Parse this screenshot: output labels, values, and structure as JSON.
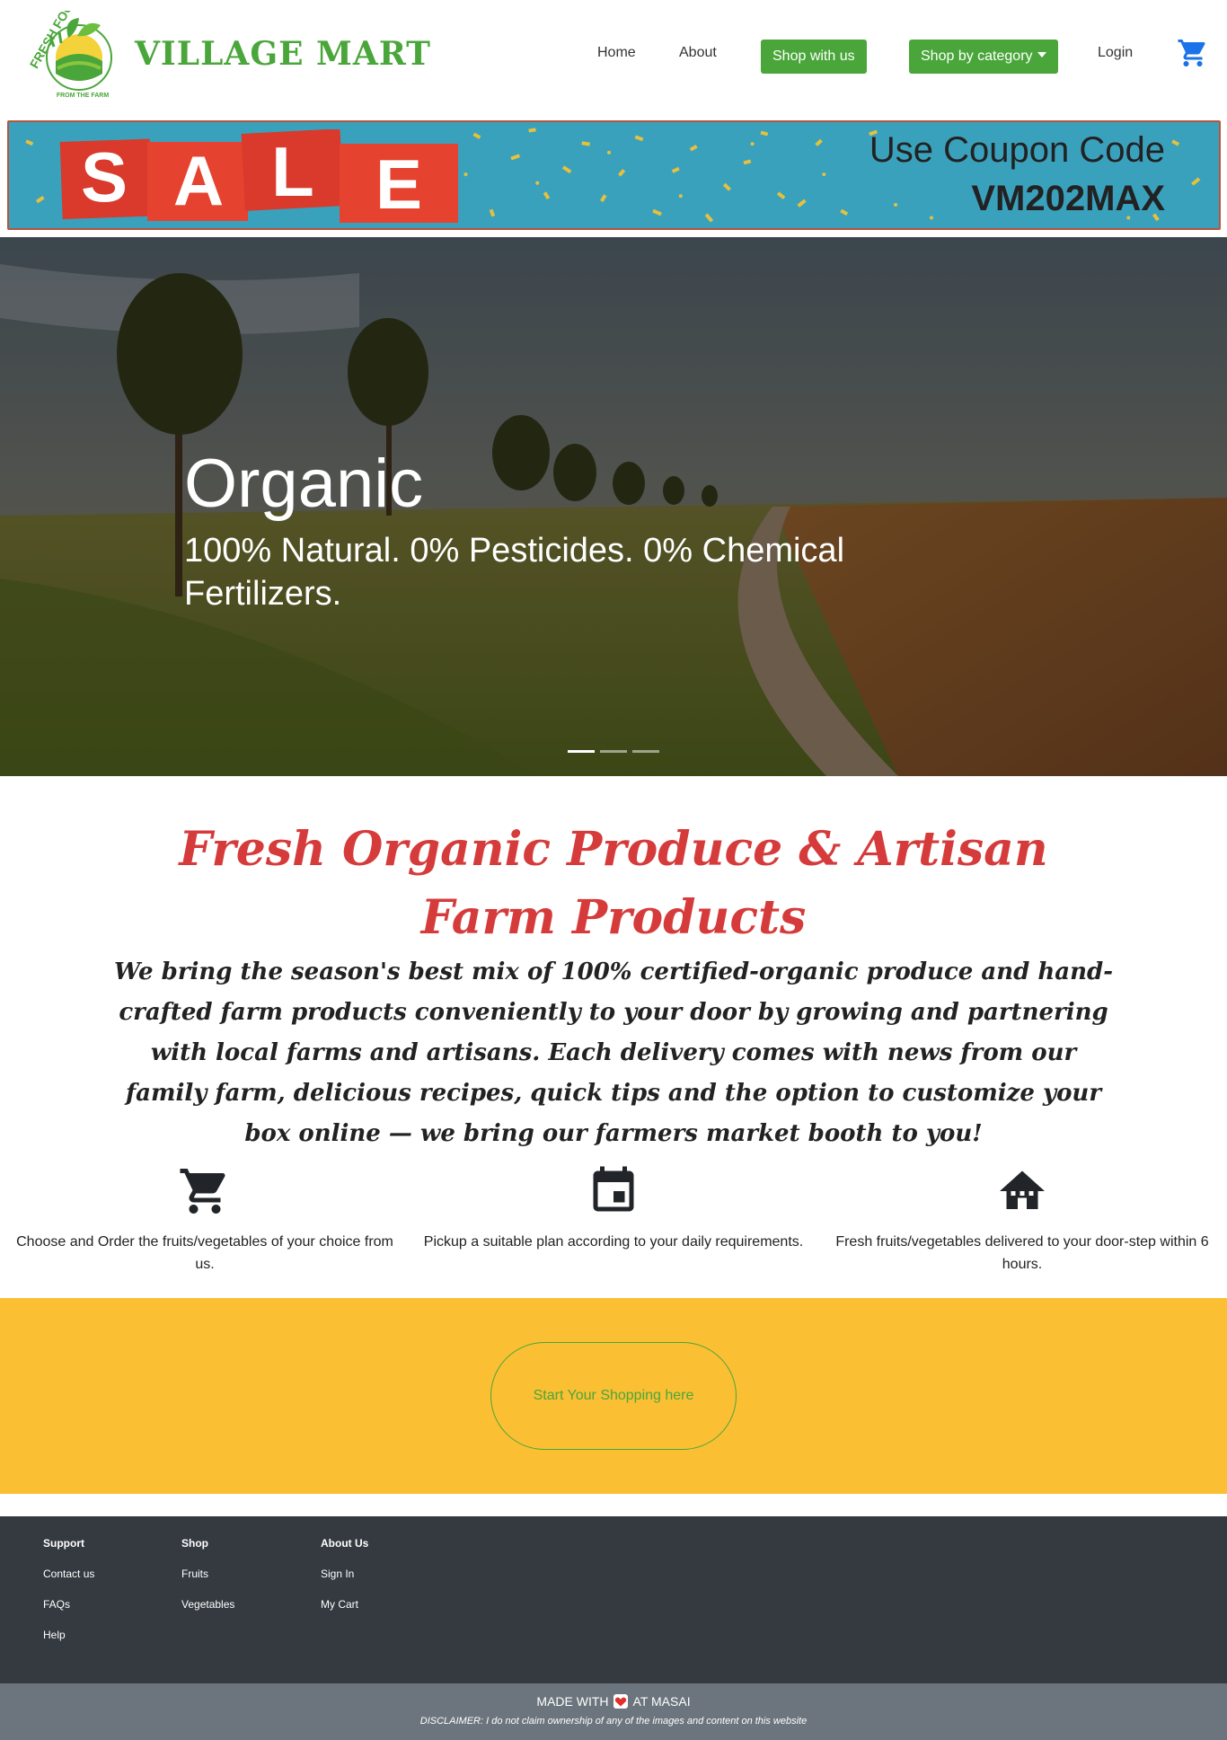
{
  "brand": {
    "name": "VILLAGE MART",
    "logo_top": "FRESH FOOD",
    "logo_bottom": "FROM THE FARM"
  },
  "nav": {
    "home": "Home",
    "about": "About",
    "shop_with_us": "Shop with us",
    "shop_by_category": "Shop by category",
    "login": "Login",
    "cart_icon": "cart-icon"
  },
  "sale_banner": {
    "sale_letters": [
      "S",
      "A",
      "L",
      "E"
    ],
    "coupon_label": "Use Coupon Code",
    "coupon_code": "VM202MAX"
  },
  "hero": {
    "title": "Organic",
    "subtitle": "100% Natural. 0% Pesticides. 0% Chemical Fertilizers.",
    "slides": 3,
    "active_slide": 0
  },
  "intro": {
    "title": "Fresh Organic Produce & Artisan Farm Products",
    "text": "We bring the season's best mix of 100% certified-organic produce and hand-crafted farm products conveniently to your door by growing and partnering with local farms and artisans. Each delivery comes with news from our family farm, delicious recipes, quick tips and the option to customize your box online — we bring our farmers market booth to you!"
  },
  "features": [
    {
      "icon": "cart-icon",
      "text": "Choose and Order the fruits/vegetables of your choice from us."
    },
    {
      "icon": "calendar-icon",
      "text": "Pickup a suitable plan according to your daily requirements."
    },
    {
      "icon": "house-icon",
      "text": "Fresh fruits/vegetables delivered to your door-step within 6 hours."
    }
  ],
  "cta": {
    "label": "Start Your Shopping here"
  },
  "footer": {
    "columns": [
      {
        "heading": "Support",
        "links": [
          "Contact us",
          "FAQs",
          "Help"
        ]
      },
      {
        "heading": "Shop",
        "links": [
          "Fruits",
          "Vegetables"
        ]
      },
      {
        "heading": "About Us",
        "links": [
          "Sign In",
          "My Cart"
        ]
      }
    ],
    "made_with_prefix": "MADE WITH",
    "made_with_suffix": "AT MASAI",
    "disclaimer": "DISCLAIMER: I do not claim ownership of any of the images and content on this website"
  },
  "colors": {
    "brand_green": "#4aa63a",
    "sale_red": "#d63b3b",
    "cta_yellow": "#fbbf33",
    "footer_dark": "#343a40",
    "footer_gray": "#6c757d",
    "banner_blue": "#3aa1bd"
  }
}
